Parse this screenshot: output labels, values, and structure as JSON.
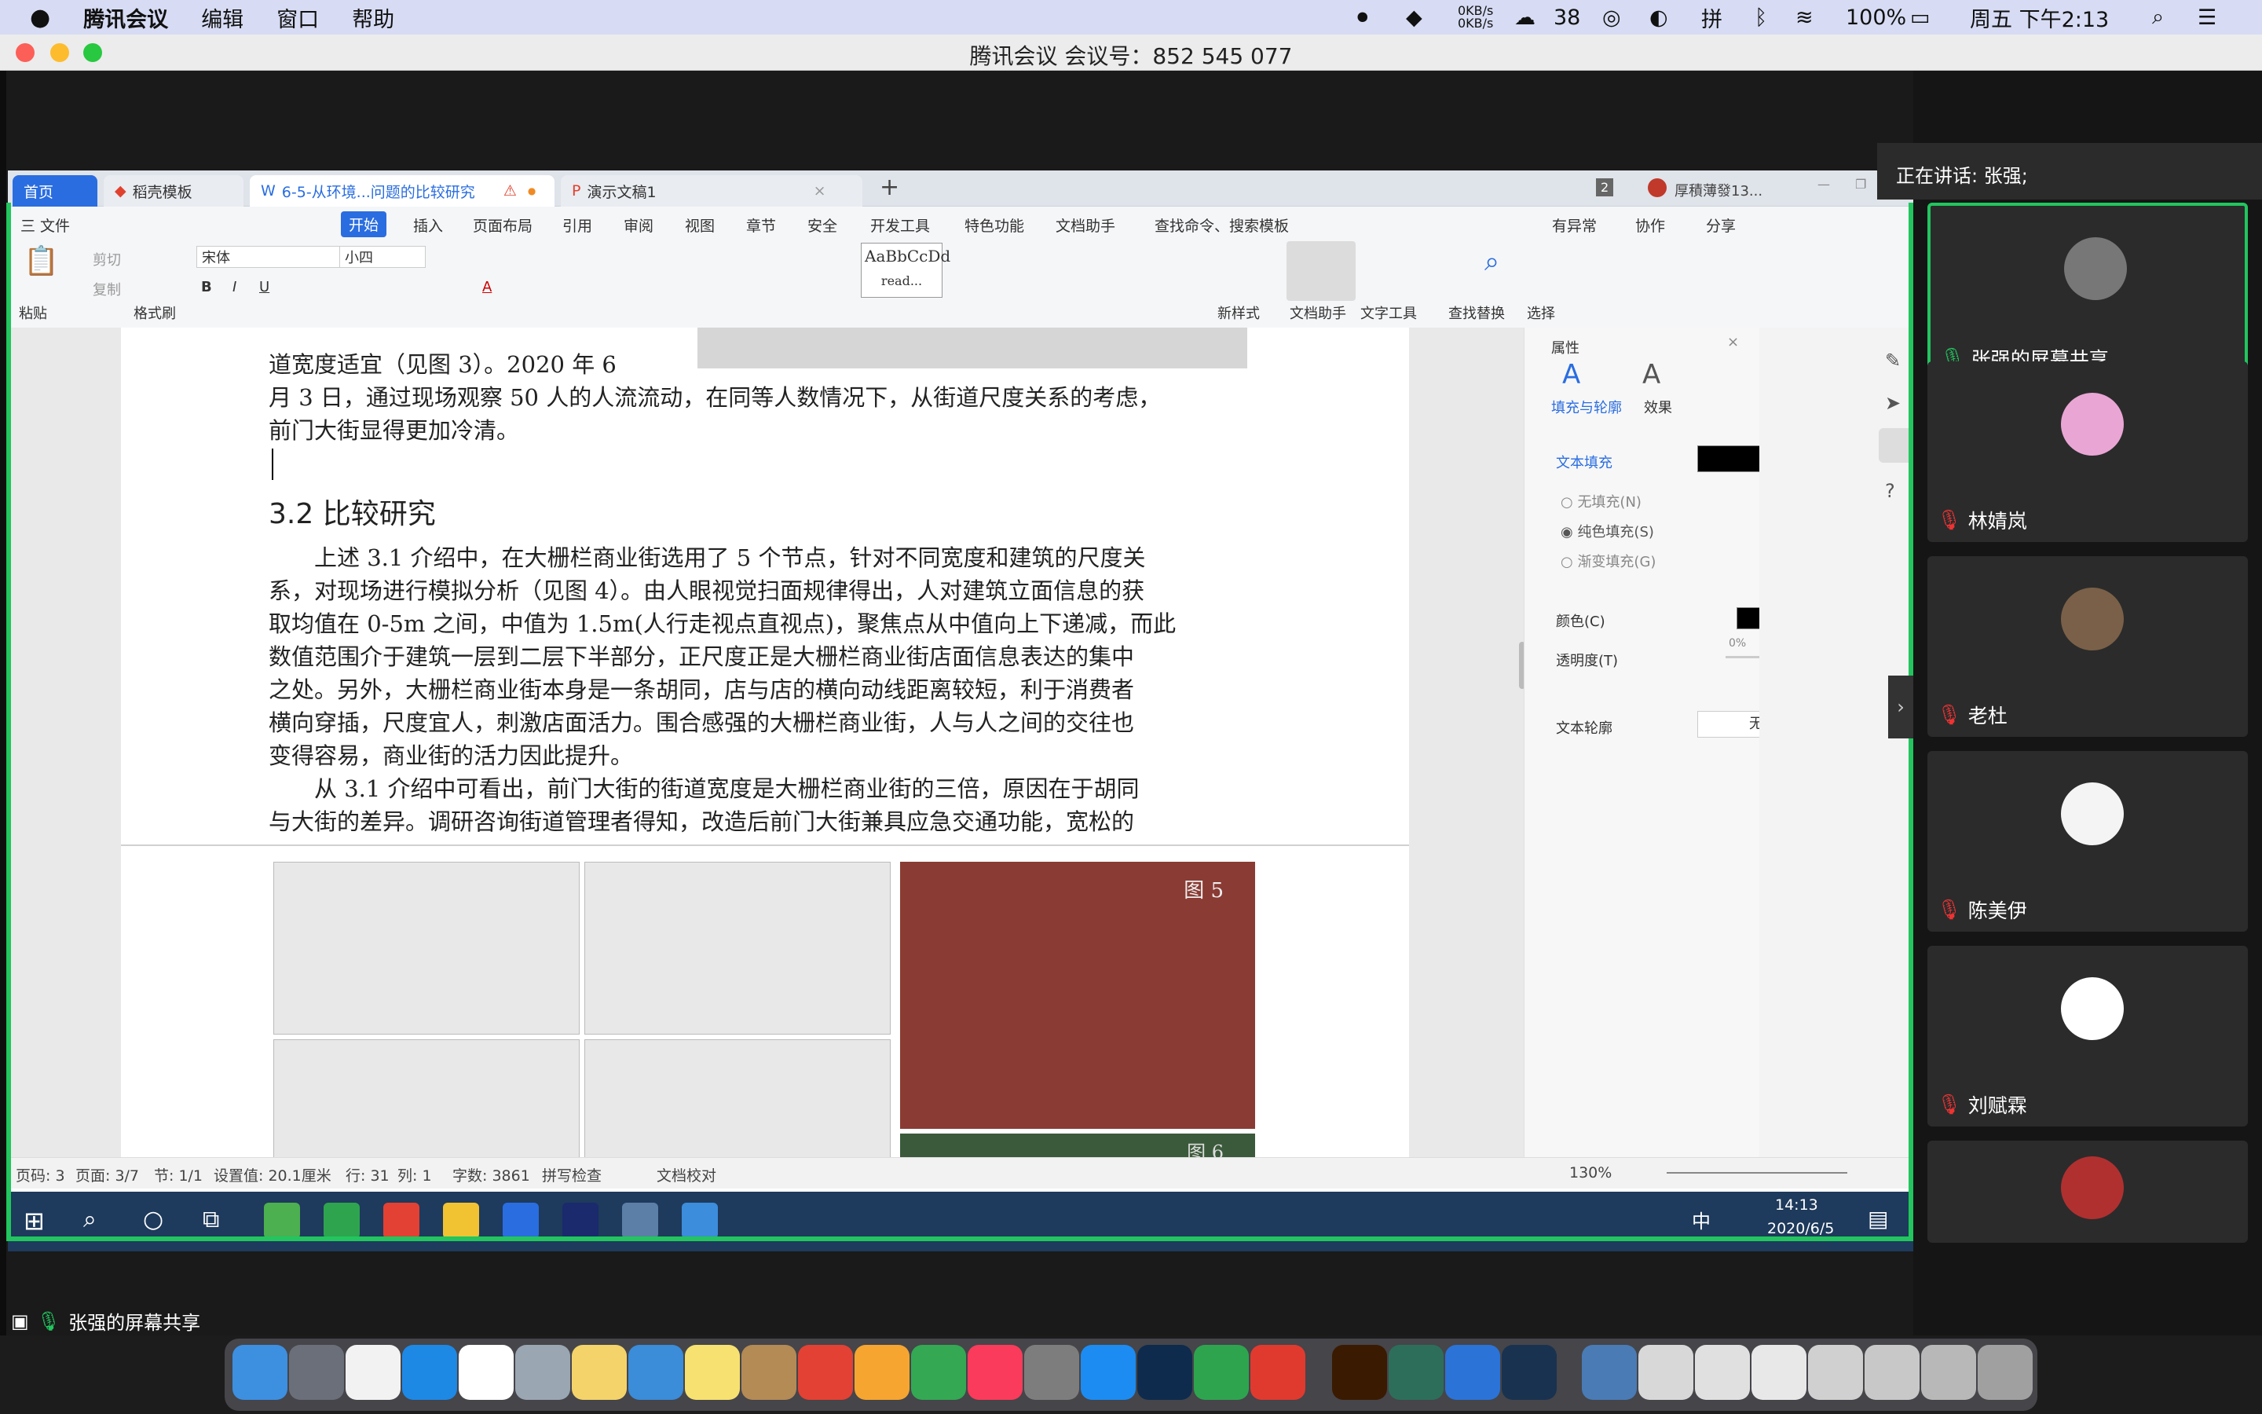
{
  "menubar": {
    "apple": "",
    "app_name": "腾讯会议",
    "menus": [
      "编辑",
      "窗口",
      "帮助"
    ],
    "net_up": "0KB/s",
    "net_down": "0KB/s",
    "wechat_count": "38",
    "battery": "100%",
    "datetime": "周五 下午2:13"
  },
  "window": {
    "title": "腾讯会议 会议号：852 545 077"
  },
  "wps": {
    "tabs": [
      {
        "label": "首页"
      },
      {
        "label": "稻壳模板"
      },
      {
        "label": "6-5-从环境...问题的比较研究"
      },
      {
        "label": "演示文稿1"
      }
    ],
    "account": "厚積薄發13...",
    "tab_count": "2",
    "ribbon_tabs": [
      "三 文件",
      "开始",
      "插入",
      "页面布局",
      "引用",
      "审阅",
      "视图",
      "章节",
      "安全",
      "开发工具",
      "特色功能",
      "文档助手",
      "查找命令、搜索模板"
    ],
    "ribbon_right": [
      "有异常",
      "协作",
      "分享"
    ],
    "toolbar": {
      "paste": "粘贴",
      "cut": "剪切",
      "copy": "复制",
      "format_brush": "格式刷",
      "font": "宋体",
      "font_size": "小四",
      "style_preview": "AaBbCcDd",
      "style_read": "read...",
      "new_style": "新样式",
      "doc_assistant": "文档助手",
      "text_tool": "文字工具",
      "find_replace": "查找替换",
      "select": "选择"
    },
    "document": {
      "lines_top": [
        "道宽度适宜（见图 3）。2020 年 6",
        "月 3 日，通过现场观察 50 人的人流流动，在同等人数情况下，从街道尺度关系的考虑，",
        "前门大街显得更加冷清。"
      ],
      "heading": "3.2 比较研究",
      "body": [
        "　　上述 3.1 介绍中，在大栅栏商业街选用了 5 个节点，针对不同宽度和建筑的尺度关",
        "系，对现场进行模拟分析（见图 4）。由人眼视觉扫面规律得出，人对建筑立面信息的获",
        "取均值在 0-5m 之间，中值为 1.5m(人行走视点直视点)，聚焦点从中值向上下递减，而此",
        "数值范围介于建筑一层到二层下半部分，正尺度正是大栅栏商业街店面信息表达的集中",
        "之处。另外，大栅栏商业街本身是一条胡同，店与店的横向动线距离较短，利于消费者",
        "横向穿插，尺度宜人，刺激店面活力。围合感强的大栅栏商业街，人与人之间的交往也",
        "变得容易，商业街的活力因此提升。",
        "　　从 3.1 介绍中可看出，前门大街的街道宽度是大栅栏商业街的三倍，原因在于胡同",
        "与大街的差异。调研咨询街道管理者得知，改造后前门大街兼具应急交通功能，宽松的"
      ],
      "figure5_label": "图 5",
      "figure6_label": "图 6"
    },
    "properties": {
      "title": "属性",
      "tab_fill": "填充与轮廓",
      "tab_effect": "效果",
      "section_fill": "文本填充",
      "options": [
        "无填充(N)",
        "纯色填充(S)",
        "渐变填充(G)"
      ],
      "selected_option": 1,
      "color_label": "颜色(C)",
      "opacity_label": "透明度(T)",
      "opacity_value": "0%",
      "outline_label": "文本轮廓",
      "outline_value": "无",
      "fill_color": "#000000"
    },
    "status": {
      "page_code": "页码: 3",
      "pages": "页面: 3/7",
      "section": "节: 1/1",
      "setting": "设置值: 20.1厘米",
      "row": "行: 31",
      "col": "列: 1",
      "words": "字数: 3861",
      "spell": "拼写检查",
      "proof": "文档校对",
      "zoom": "130%"
    },
    "taskbar": {
      "time": "14:13",
      "date": "2020/6/5",
      "ime": "中"
    }
  },
  "meeting": {
    "speaking": "正在讲话: 张强;",
    "participants": [
      {
        "name": "张强的屏幕共享",
        "highlight": true
      },
      {
        "name": "林婧岚"
      },
      {
        "name": "老杜"
      },
      {
        "name": "陈美伊"
      },
      {
        "name": "刘赋霖"
      },
      {
        "name": ""
      }
    ],
    "bottom_share_label": "张强的屏幕共享"
  },
  "colors": {
    "accent_green": "#22c55e",
    "wps_blue": "#2a6de0",
    "menubar_bg": "#d7dcf4"
  }
}
